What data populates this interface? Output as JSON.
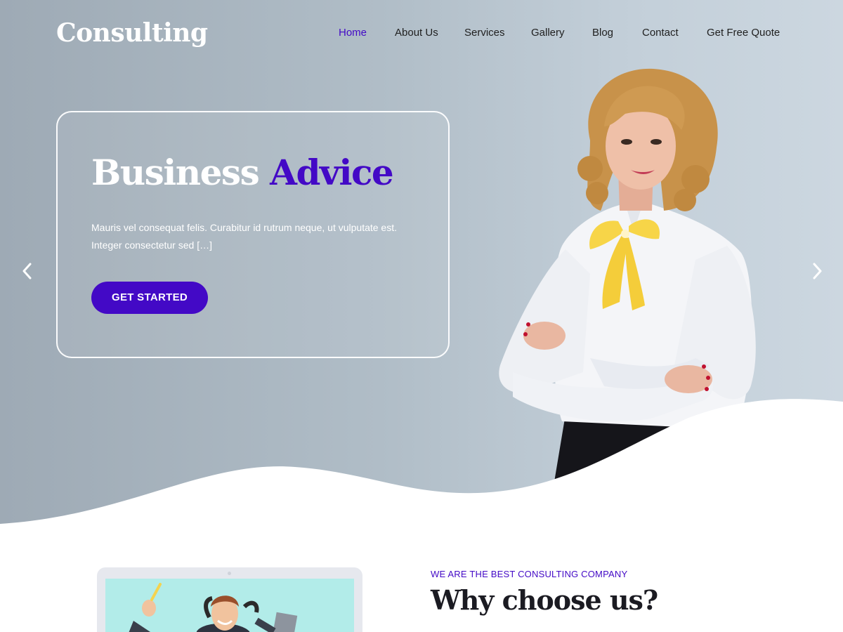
{
  "site": {
    "logo": "Consulting"
  },
  "nav": {
    "items": [
      {
        "label": "Home",
        "active": true
      },
      {
        "label": "About Us",
        "active": false
      },
      {
        "label": "Services",
        "active": false
      },
      {
        "label": "Gallery",
        "active": false
      },
      {
        "label": "Blog",
        "active": false
      },
      {
        "label": "Contact",
        "active": false
      },
      {
        "label": "Get Free Quote",
        "active": false
      }
    ]
  },
  "slider": {
    "title_part1": "Business",
    "title_part2": "Advice",
    "text": "Mauris vel consequat felis. Curabitur id rutrum neque, ut vulputate est. Integer consectetur sed […]",
    "cta_label": "GET STARTED",
    "prev_icon": "chevron-left-icon",
    "next_icon": "chevron-right-icon"
  },
  "about": {
    "eyebrow": "WE ARE THE BEST CONSULTING COMPANY",
    "heading": "Why choose us?"
  },
  "colors": {
    "accent": "#4309c6",
    "hero_bg_left": "#9eaab5",
    "hero_bg_right": "#ccd7e0",
    "bow": "#f7d548",
    "laptop_screen": "#b2ece9"
  }
}
